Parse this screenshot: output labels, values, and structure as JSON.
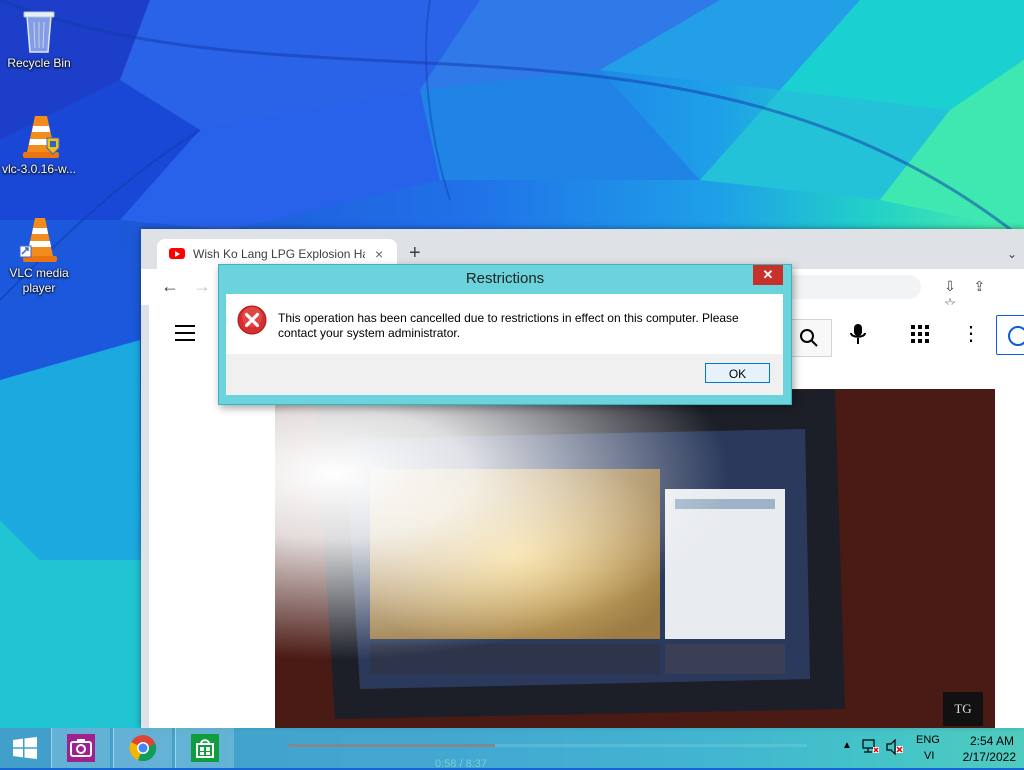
{
  "desktop": {
    "icons": [
      {
        "label": "Recycle Bin",
        "icon": "recycle-bin-icon"
      },
      {
        "label": "vlc-3.0.16-w...",
        "icon": "vlc-installer-icon"
      },
      {
        "label": "VLC media player",
        "icon": "vlc-icon"
      }
    ]
  },
  "browser": {
    "tab_title": "Wish Ko Lang LPG Explosion Has",
    "tab_close": "×",
    "new_tab": "+",
    "tab_menu": "⌄",
    "back": "←",
    "forward": "→",
    "toolbar_icons": [
      "install-icon",
      "share-icon",
      "bookmark-star-icon"
    ],
    "video_time": "0:58 / 8:37"
  },
  "dialog": {
    "title": "Restrictions",
    "close": "✕",
    "message": "This operation has been cancelled due to restrictions in effect on this computer. Please contact your system administrator.",
    "ok_label": "OK",
    "icon": "error-icon"
  },
  "taskbar": {
    "apps": [
      "camera-app-icon",
      "chrome-icon",
      "store-icon"
    ],
    "lang_top": "ENG",
    "lang_bottom": "VI",
    "time": "2:54 AM",
    "date": "2/17/2022"
  },
  "colors": {
    "wallpaper_blue": "#1565d8",
    "wallpaper_teal": "#26c6da",
    "wallpaper_green": "#1de9b6",
    "dialog_frame": "#6bd3dc",
    "close_red": "#c7312a",
    "youtube_red": "#ff0000"
  }
}
